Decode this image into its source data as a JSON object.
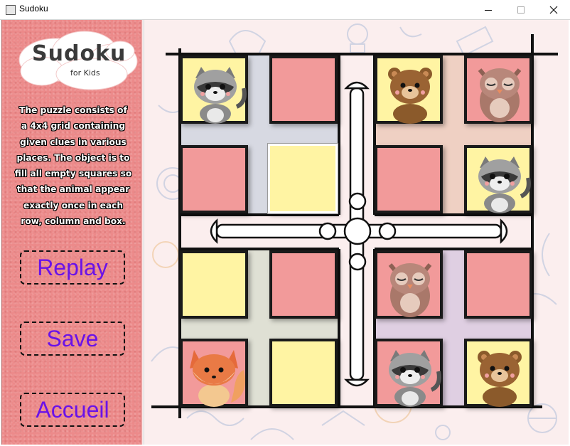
{
  "window": {
    "title": "Sudoku",
    "controls": [
      "minimize",
      "maximize",
      "close"
    ]
  },
  "sidebar": {
    "logo_title": "Sudoku",
    "logo_subtitle": "for Kids",
    "description_lines": [
      "The puzzle consists of",
      "a 4x4 grid containing",
      "given clues in various",
      "places. The object is to",
      "fill all empty squares so",
      "that the animal appear",
      "exactly once in each",
      "row, column and box."
    ],
    "buttons": {
      "replay": "Replay",
      "save": "Save",
      "home": "Accueil"
    }
  },
  "board": {
    "rows": [
      [
        {
          "color": "yellow",
          "animal": "raccoon"
        },
        {
          "color": "pink",
          "animal": ""
        },
        {
          "color": "yellow",
          "animal": "bear"
        },
        {
          "color": "pink",
          "animal": "owl"
        }
      ],
      [
        {
          "color": "pink",
          "animal": ""
        },
        {
          "color": "yellow",
          "animal": "",
          "selected": true
        },
        {
          "color": "pink",
          "animal": ""
        },
        {
          "color": "yellow",
          "animal": "raccoon"
        }
      ],
      [
        {
          "color": "yellow",
          "animal": ""
        },
        {
          "color": "pink",
          "animal": ""
        },
        {
          "color": "pink",
          "animal": "owl"
        },
        {
          "color": "pink",
          "animal": ""
        }
      ],
      [
        {
          "color": "pink",
          "animal": "fox"
        },
        {
          "color": "yellow",
          "animal": ""
        },
        {
          "color": "pink",
          "animal": "raccoon"
        },
        {
          "color": "yellow",
          "animal": "bear"
        }
      ]
    ],
    "box_colors": [
      "#b9c9d8",
      "#e6b8a0",
      "#c9d6bf",
      "#c9b7d8"
    ],
    "colors": {
      "pink": "#f29a9a",
      "yellow": "#fff4a3",
      "sidebar": "#ec8a8a",
      "button_text": "#6a12e8"
    }
  }
}
